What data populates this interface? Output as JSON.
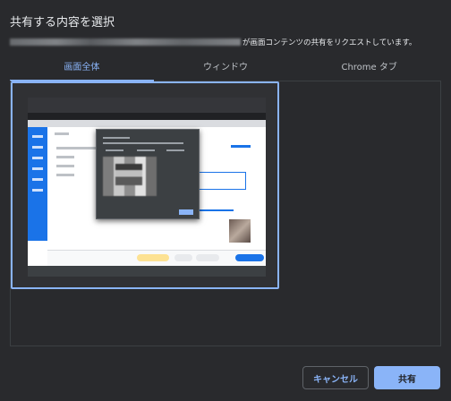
{
  "dialog": {
    "title": "共有する内容を選択",
    "subtitle": "が画面コンテンツの共有をリクエストしています。"
  },
  "tabs": [
    {
      "label": "画面全体",
      "active": true
    },
    {
      "label": "ウィンドウ",
      "active": false
    },
    {
      "label": "Chrome タブ",
      "active": false
    }
  ],
  "buttons": {
    "cancel": "キャンセル",
    "share": "共有"
  },
  "colors": {
    "accent": "#8ab4f8",
    "background": "#292a2d"
  }
}
